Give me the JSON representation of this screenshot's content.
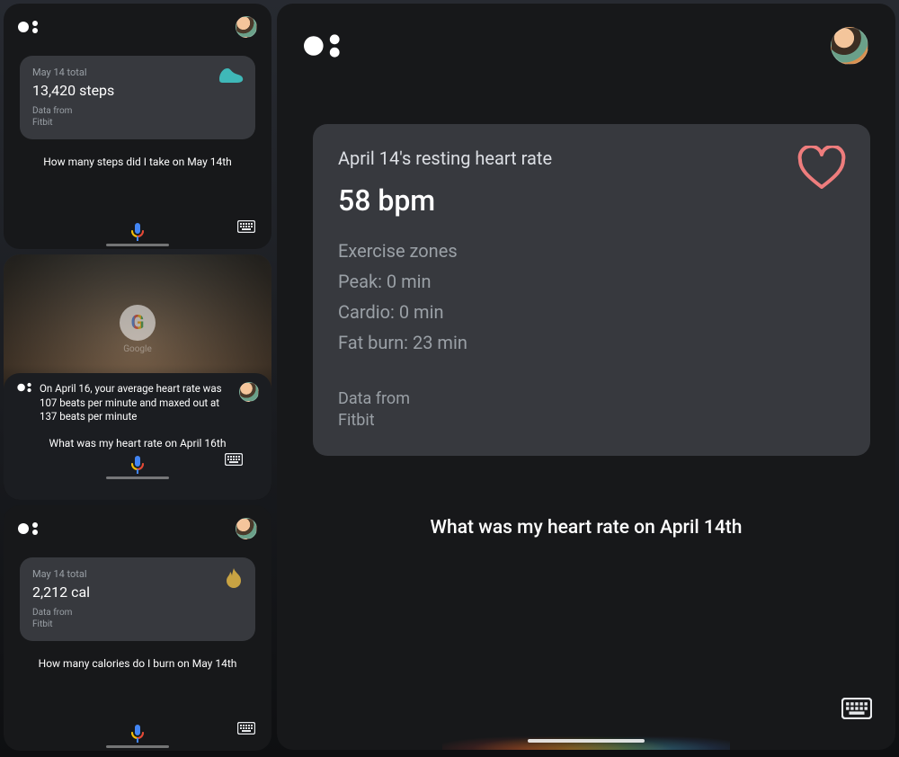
{
  "cards": {
    "steps": {
      "label": "May 14 total",
      "value": "13,420 steps",
      "source_line1": "Data from",
      "source_line2": "Fitbit",
      "query": "How many steps did I take on May 14th"
    },
    "hr_text": {
      "response": "On April 16, your average heart rate was 107 beats per minute and maxed out at 137 beats per minute",
      "query": "What was my heart rate on April 16th",
      "search_label": "Google"
    },
    "calories": {
      "label": "May 14 total",
      "value": "2,212 cal",
      "source_line1": "Data from",
      "source_line2": "Fitbit",
      "query": "How many calories do I burn on May 14th"
    },
    "resting_hr": {
      "label": "April 14's resting heart rate",
      "value": "58 bpm",
      "zones_title": "Exercise zones",
      "peak": "Peak: 0 min",
      "cardio": "Cardio: 0 min",
      "fatburn": "Fat burn: 23 min",
      "source_line1": "Data from",
      "source_line2": "Fitbit",
      "query": "What was my heart rate on April 14th"
    }
  }
}
